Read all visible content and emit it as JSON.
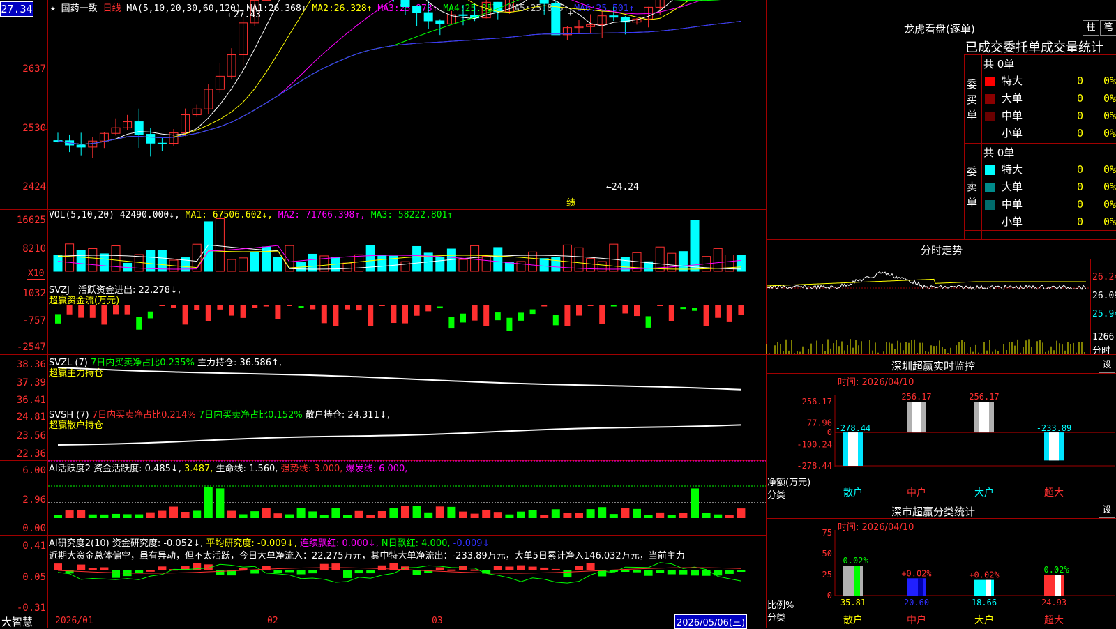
{
  "colors": {
    "up": "#ff3030",
    "down": "#00ffff",
    "grid": "#a00000",
    "ma1": "#ffffff",
    "ma2": "#ffff00",
    "ma3": "#ff00ff",
    "ma4": "#00ff00",
    "ma5": "#c0c0c0",
    "ma6": "#3030ff",
    "yellow": "#ffff00",
    "green": "#00ff00"
  },
  "current_price": "27.34",
  "header": {
    "star": "★",
    "name": "国药一致",
    "period": "日线",
    "ma_params": "MA(5,10,20,30,60,120)",
    "ma": [
      {
        "label": "MA1:",
        "value": "26.368↓"
      },
      {
        "label": "MA2:",
        "value": "26.328↑"
      },
      {
        "label": "MA3:",
        "value": "25.973↑"
      },
      {
        "label": "MA4:",
        "value": "25.857↑"
      },
      {
        "label": "MA5:",
        "value": "25.816↑"
      },
      {
        "label": "MA6:",
        "value": "25.501↑"
      }
    ]
  },
  "price_axis": [
    "2637",
    "2530",
    "2424"
  ],
  "annotations": {
    "high": "27.43",
    "low": "24.24",
    "marker": "绩"
  },
  "vol": {
    "params": "VOL(5,10,20)",
    "value": "42490.000↓,",
    "ma1": "MA1: 67506.602↓,",
    "ma2": "MA2: 71766.398↑,",
    "ma3": "MA3: 58222.801↑",
    "axis": [
      "16625",
      "8210"
    ],
    "unit": "X10"
  },
  "svzj": {
    "title": "SVZJ",
    "label": "活跃资金进出: 22.278↓,",
    "sub": "超赢资金流(万元)",
    "axis": [
      "1032",
      "-757",
      "-2547"
    ]
  },
  "svzl": {
    "title": "SVZL (7)",
    "p1": "7日内买卖净占比0.235%",
    "p2": "主力持仓: 36.586↑,",
    "sub": "超赢主力持仓",
    "axis": [
      "38.36",
      "37.39",
      "36.41"
    ]
  },
  "svsh": {
    "title": "SVSH (7)",
    "p1": "7日内买卖净占比0.214%",
    "p2": "7日内买卖净占比0.152%",
    "p3": "散户持仓: 24.311↓,",
    "sub": "超赢散户持仓",
    "axis": [
      "24.81",
      "23.56",
      "22.36"
    ]
  },
  "ai1": {
    "title": "AI活跃度2",
    "p1": "资金活跃度: 0.485↓,",
    "p2": "3.487,",
    "p3": "生命线: 1.560,",
    "p4": "强势线: 3.000,",
    "p5": "爆发线: 6.000,",
    "axis": [
      "6.00",
      "2.96",
      "0.00"
    ]
  },
  "ai2": {
    "title": "AI研究度2(10)",
    "p1": "资金研究度: -0.052↓,",
    "p2": "平均研究度: -0.009↓,",
    "p3": "连续飘红: 0.000↓,",
    "p4": "N日飘红: 4.000,",
    "p5": "-0.009↓",
    "text": "近期大资金总体偏空，虽有异动，但不太活跃，今日大单净流入：22.275万元，其中特大单净流出：-233.89万元，大单5日累计净入146.032万元，当前主力",
    "axis": [
      "0.41",
      "0.05",
      "-0.31"
    ]
  },
  "xaxis": {
    "left": "大智慧",
    "dates": [
      "2026/01",
      "02",
      "03"
    ],
    "current": "2026/05/06(三)"
  },
  "dragon": {
    "title": "龙虎看盘(逐单)",
    "btn1": "柱",
    "btn2": "笔",
    "subtitle": "已成交委托单成交量统计",
    "buy": {
      "label": "委买单",
      "total": "共 0单",
      "rows": [
        {
          "name": "特大",
          "count": "0",
          "pct": "0%",
          "color": "#ff0000"
        },
        {
          "name": "大单",
          "count": "0",
          "pct": "0%",
          "color": "#8b0000"
        },
        {
          "name": "中单",
          "count": "0",
          "pct": "0%",
          "color": "#6a0000"
        },
        {
          "name": "小单",
          "count": "0",
          "pct": "0%",
          "color": ""
        }
      ]
    },
    "sell": {
      "label": "委卖单",
      "total": "共 0单",
      "rows": [
        {
          "name": "特大",
          "count": "0",
          "pct": "0%",
          "color": "#00ffff"
        },
        {
          "name": "大单",
          "count": "0",
          "pct": "0%",
          "color": "#008b8b"
        },
        {
          "name": "中单",
          "count": "0",
          "pct": "0%",
          "color": "#006b6b"
        },
        {
          "name": "小单",
          "count": "0",
          "pct": "0%",
          "color": ""
        }
      ]
    }
  },
  "fenshi": {
    "title": "分时走势",
    "axis": [
      "26.24",
      "26.09",
      "25.94"
    ],
    "vol": "1266",
    "unit": "分时"
  },
  "monitor": {
    "title": "深圳超赢实时监控",
    "btn": "设",
    "time": "时间: 2026/04/10",
    "axis": [
      "256.17",
      "77.96",
      "0",
      "-100.24",
      "-278.44"
    ],
    "ylabel": "净额(万元)",
    "xlabel": "分类",
    "cats": [
      "散户",
      "中户",
      "大户",
      "超大"
    ],
    "values": [
      -278.44,
      256.17,
      256.17,
      -233.89
    ],
    "value_labels": [
      "-278.44",
      "256.17",
      "256.17",
      "-233.89"
    ]
  },
  "classify": {
    "title": "深市超赢分类统计",
    "btn": "设",
    "time": "时间: 2026/04/10",
    "axis": [
      "75",
      "50",
      "25",
      "0"
    ],
    "ylabel": "比例%",
    "xlabel": "分类",
    "cats": [
      "散户",
      "中户",
      "大户",
      "超大"
    ],
    "values": [
      35.81,
      20.6,
      18.66,
      24.93
    ],
    "value_labels": [
      "35.81",
      "20.60",
      "18.66",
      "24.93"
    ],
    "top_labels": [
      "-0.02%",
      "+0.02%",
      "+0.02%",
      "-0.02%"
    ]
  }
}
